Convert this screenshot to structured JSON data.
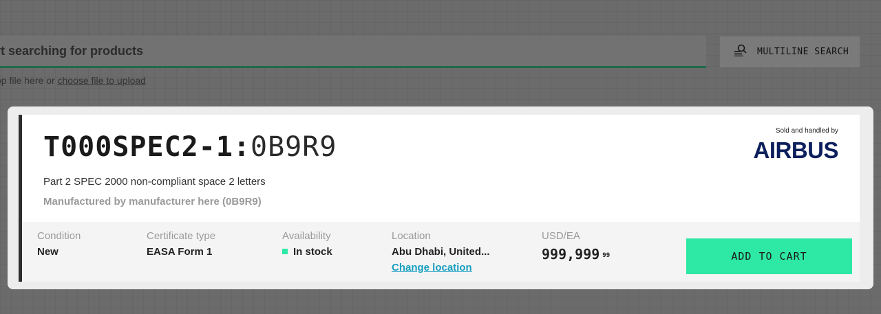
{
  "search": {
    "placeholder": "rt searching for products",
    "multiline_label": "MULTILINE SEARCH",
    "upload_prefix": "op file here or ",
    "upload_link": "choose file to upload"
  },
  "product": {
    "part_number": "T000SPEC2-1",
    "separator": ":",
    "manufacturer_code": "0B9R9",
    "description": "Part 2 SPEC 2000 non-compliant space 2 letters",
    "manufactured_by": "Manufactured by manufacturer here (0B9R9)",
    "sold_by_label": "Sold and handled by",
    "seller_logo_text": "AIRBUS"
  },
  "details": {
    "condition_label": "Condition",
    "condition_value": "New",
    "certificate_label": "Certificate type",
    "certificate_value": "EASA Form 1",
    "availability_label": "Availability",
    "availability_value": "In stock",
    "location_label": "Location",
    "location_value": "Abu Dhabi, United...",
    "change_location": "Change location",
    "price_label": "USD/EA",
    "price_main": "999,999",
    "price_cents": "99"
  },
  "actions": {
    "add_to_cart": "ADD TO CART"
  },
  "colors": {
    "accent": "#2ee8a5",
    "link": "#1aa0c0",
    "brand": "#0c1f5c"
  }
}
